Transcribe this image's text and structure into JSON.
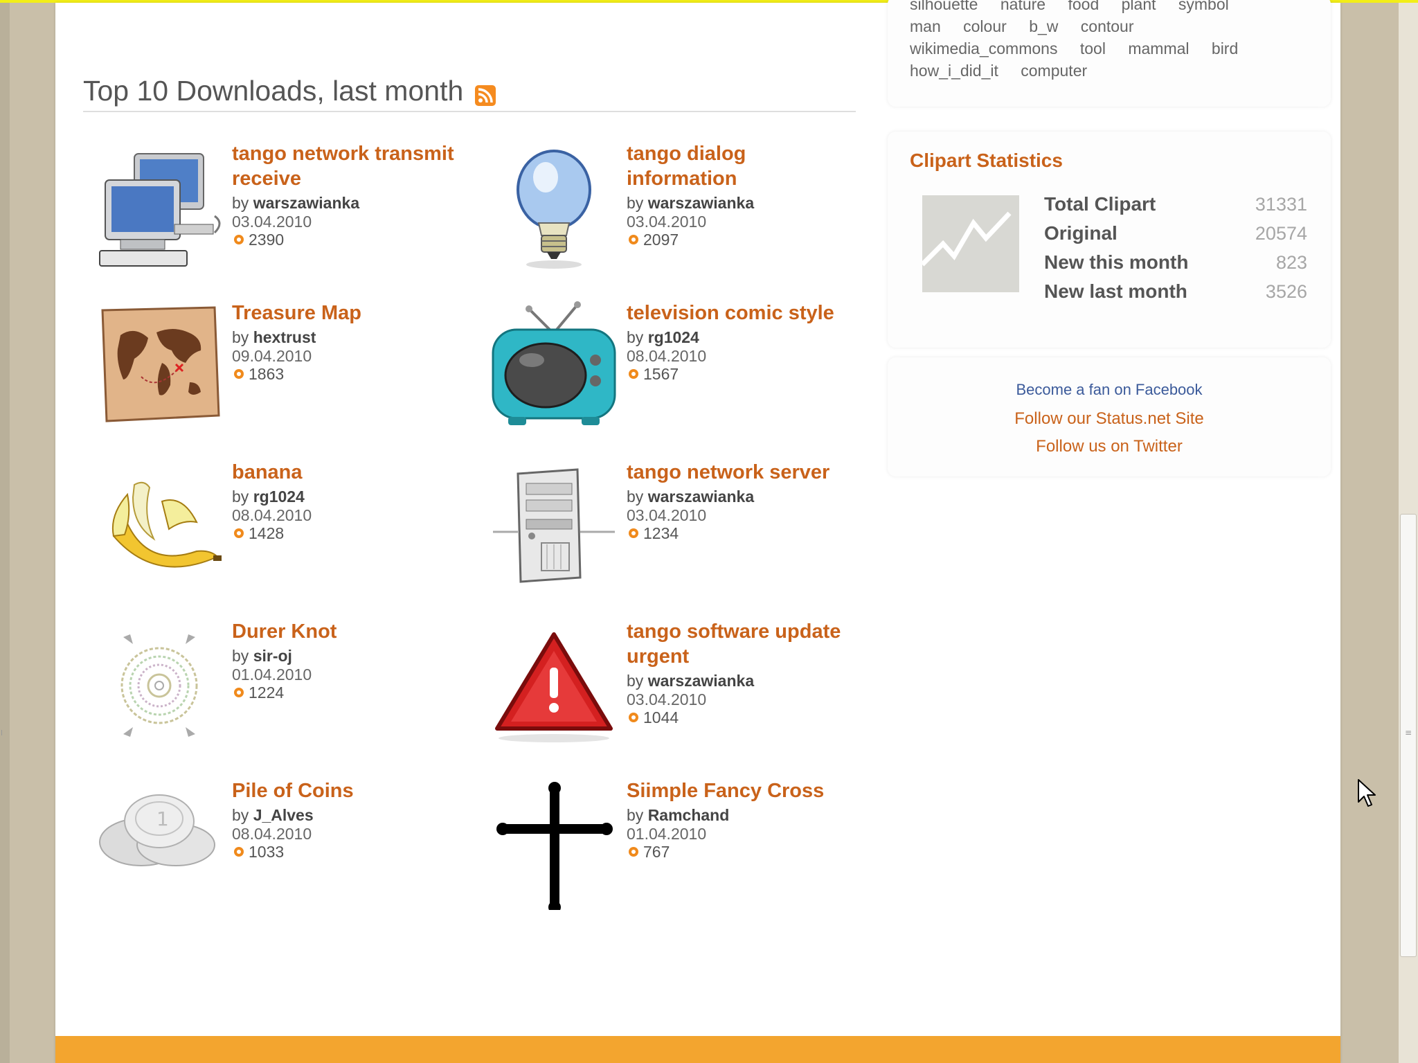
{
  "section": {
    "title": "Top 10 Downloads, last month"
  },
  "items": [
    {
      "title_line1": "tango network transmit",
      "title_line2": "receive",
      "by_prefix": "by",
      "author": "warszawianka",
      "date": "03.04.2010",
      "downloads": "2390",
      "icon": "computers-icon"
    },
    {
      "title_line1": "tango dialog",
      "title_line2": "information",
      "by_prefix": "by",
      "author": "warszawianka",
      "date": "03.04.2010",
      "downloads": "2097",
      "icon": "light-bulb-icon"
    },
    {
      "title_line1": "Treasure Map",
      "title_line2": "",
      "by_prefix": "by",
      "author": "hextrust",
      "date": "09.04.2010",
      "downloads": "1863",
      "icon": "treasure-map-icon"
    },
    {
      "title_line1": "television comic style",
      "title_line2": "",
      "by_prefix": "by",
      "author": "rg1024",
      "date": "08.04.2010",
      "downloads": "1567",
      "icon": "television-icon"
    },
    {
      "title_line1": "banana",
      "title_line2": "",
      "by_prefix": "by",
      "author": "rg1024",
      "date": "08.04.2010",
      "downloads": "1428",
      "icon": "banana-icon"
    },
    {
      "title_line1": "tango network server",
      "title_line2": "",
      "by_prefix": "by",
      "author": "warszawianka",
      "date": "03.04.2010",
      "downloads": "1234",
      "icon": "server-icon"
    },
    {
      "title_line1": "Durer Knot",
      "title_line2": "",
      "by_prefix": "by",
      "author": "sir-oj",
      "date": "01.04.2010",
      "downloads": "1224",
      "icon": "knot-icon"
    },
    {
      "title_line1": "tango software update",
      "title_line2": "urgent",
      "by_prefix": "by",
      "author": "warszawianka",
      "date": "03.04.2010",
      "downloads": "1044",
      "icon": "warning-triangle-icon"
    },
    {
      "title_line1": "Pile of Coins",
      "title_line2": "",
      "by_prefix": "by",
      "author": "J_Alves",
      "date": "08.04.2010",
      "downloads": "1033",
      "icon": "coins-icon"
    },
    {
      "title_line1": "Siimple Fancy Cross",
      "title_line2": "",
      "by_prefix": "by",
      "author": "Ramchand",
      "date": "01.04.2010",
      "downloads": "767",
      "icon": "cross-icon"
    }
  ],
  "tags": {
    "row0": [
      "silhouette",
      "nature",
      "food",
      "plant",
      "symbol"
    ],
    "row1": [
      "man",
      "colour",
      "b_w",
      "contour"
    ],
    "row2": [
      "wikimedia_commons",
      "tool",
      "mammal",
      "bird"
    ],
    "row3": [
      "how_i_did_it",
      "computer"
    ]
  },
  "stats": {
    "title": "Clipart Statistics",
    "rows": [
      {
        "label": "Total Clipart",
        "value": "31331"
      },
      {
        "label": "Original",
        "value": "20574"
      },
      {
        "label": "New this month",
        "value": "823"
      },
      {
        "label": "New last month",
        "value": "3526"
      }
    ]
  },
  "social": {
    "facebook": "Become a fan on Facebook",
    "statusnet": "Follow our Status.net Site",
    "twitter": "Follow us on Twitter"
  },
  "colors": {
    "accent": "#c9621a",
    "footer": "#f3a52f",
    "topline": "#f2ee18",
    "link_blue": "#3b5a9a"
  }
}
